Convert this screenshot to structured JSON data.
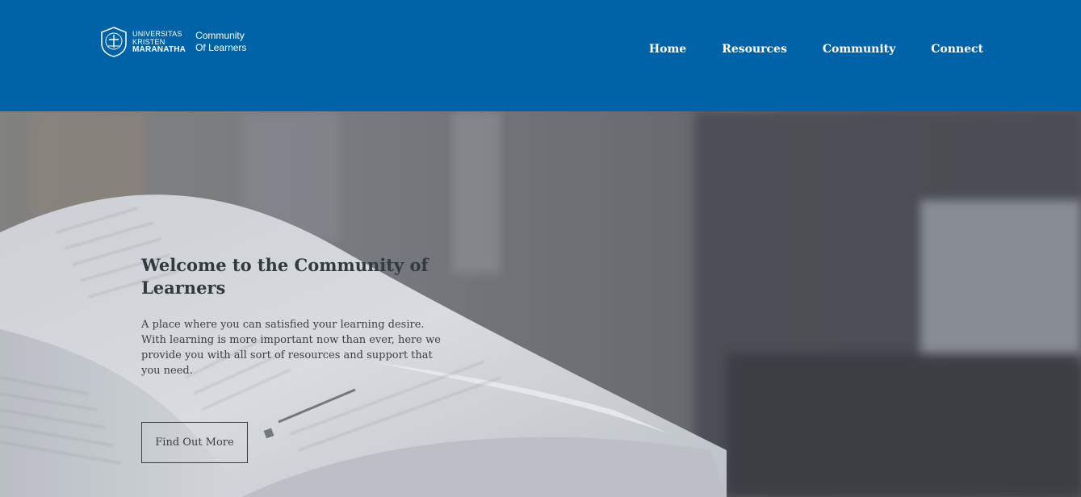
{
  "brand": {
    "university_line1": "UNIVERSITAS",
    "university_line2": "KRISTEN",
    "university_line3": "MARANATHA",
    "community_line1": "Community",
    "community_line2": "Of Learners",
    "header_color": "#0063a8"
  },
  "nav": {
    "items": [
      {
        "label": "Home"
      },
      {
        "label": "Resources"
      },
      {
        "label": "Community"
      },
      {
        "label": "Connect"
      }
    ]
  },
  "hero": {
    "title": "Welcome to the Community of Learners",
    "text": "A place where you can satisfied your learning desire. With learning is more important now than ever, here we provide you with all sort of resources and support that you need.",
    "cta_label": "Find Out More"
  }
}
